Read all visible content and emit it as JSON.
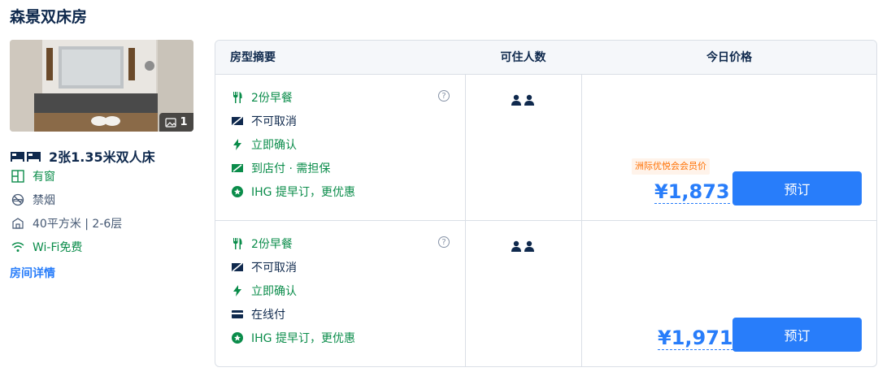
{
  "room": {
    "title": "森景双床房",
    "photo_count": "1",
    "bed": "2张1.35米双人床",
    "window": "有窗",
    "smoking": "禁烟",
    "area_floor": "40平方米 | 2-6层",
    "wifi": "Wi-Fi免费",
    "detail_link": "房间详情"
  },
  "table": {
    "headers": {
      "summary": "房型摘要",
      "occupancy": "可住人数",
      "price": "今日价格"
    },
    "rates": [
      {
        "perks": [
          {
            "icon": "utensils-icon",
            "text": "2份早餐",
            "color": "green"
          },
          {
            "icon": "no-cancel-icon",
            "text": "不可取消",
            "color": "dark"
          },
          {
            "icon": "lightning-icon",
            "text": "立即确认",
            "color": "green"
          },
          {
            "icon": "pay-at-hotel-icon",
            "text": "到店付 · 需担保",
            "color": "green"
          },
          {
            "icon": "ihg-badge-icon",
            "text": "IHG 提早订，更优惠",
            "color": "green"
          }
        ],
        "guests": 2,
        "member_tag": "洲际优悦会会员价",
        "price": "¥1,873",
        "book_label": "预订"
      },
      {
        "perks": [
          {
            "icon": "utensils-icon",
            "text": "2份早餐",
            "color": "green"
          },
          {
            "icon": "no-cancel-icon",
            "text": "不可取消",
            "color": "dark"
          },
          {
            "icon": "lightning-icon",
            "text": "立即确认",
            "color": "green"
          },
          {
            "icon": "card-icon",
            "text": "在线付",
            "color": "dark"
          },
          {
            "icon": "ihg-badge-icon",
            "text": "IHG 提早订，更优惠",
            "color": "green"
          }
        ],
        "guests": 2,
        "member_tag": "",
        "price": "¥1,971",
        "book_label": "预订"
      }
    ]
  },
  "colors": {
    "accent": "#287dfa",
    "green": "#0a8c4a",
    "text": "#0f294d",
    "tag_bg": "#fff3ea",
    "tag_text": "#ff6f00"
  }
}
